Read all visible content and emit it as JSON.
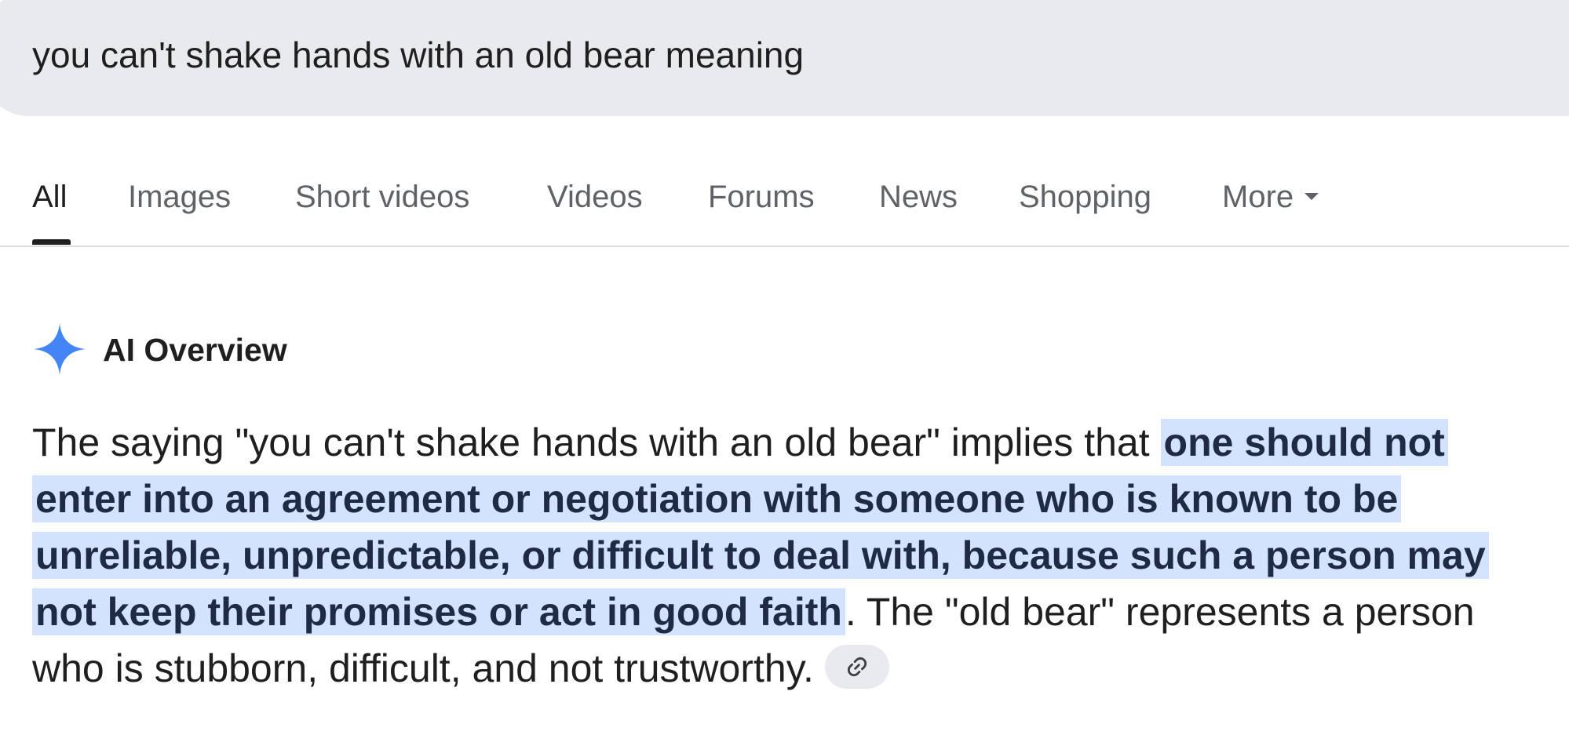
{
  "search": {
    "query": "you can't shake hands with an old bear meaning"
  },
  "tabs": [
    {
      "label": "All",
      "active": true
    },
    {
      "label": "Images"
    },
    {
      "label": "Short videos"
    },
    {
      "label": "Videos"
    },
    {
      "label": "Forums"
    },
    {
      "label": "News"
    },
    {
      "label": "Shopping"
    },
    {
      "label": "More"
    }
  ],
  "ai_overview": {
    "title": "AI Overview",
    "icon": "sparkle-icon",
    "text_before": "The saying \"you can't shake hands with an old bear\" implies that ",
    "text_highlight": "one should not enter into an agreement or negotiation with someone who is known to be unreliable, unpredictable, or difficult to deal with, because such a person may not keep their promises or act in good faith",
    "text_after": ". The \"old bear\" represents a person who is stubborn, difficult, and not trustworthy.",
    "link_icon": "link-icon"
  },
  "colors": {
    "search_bg": "#e9eaed",
    "highlight_bg": "#d3e3fd",
    "sparkle": "#4285f4",
    "tab_inactive": "#5f6368",
    "tab_active": "#1f1f1f"
  }
}
